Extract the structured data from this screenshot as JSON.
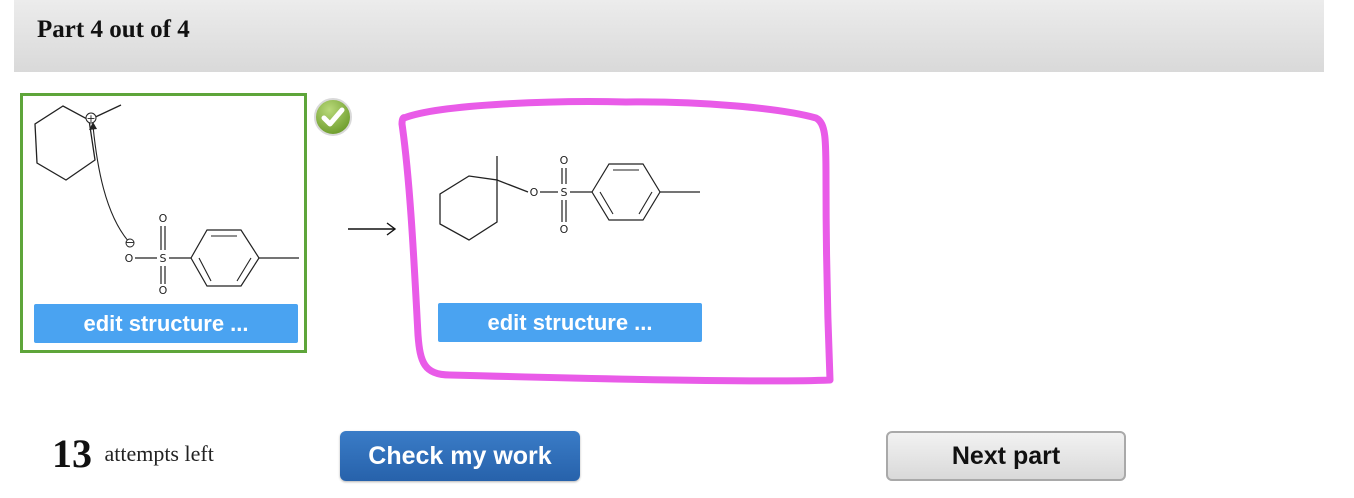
{
  "header": {
    "part_title": "Part 4 out of 4"
  },
  "reactant": {
    "edit_label": "edit structure ...",
    "atoms": {
      "o_minus": "O",
      "s": "S",
      "o_top": "O",
      "o_bottom": "O",
      "charge_plus": "+",
      "charge_minus": "−"
    },
    "status_icon": "check-icon"
  },
  "product": {
    "edit_label": "edit structure ...",
    "atoms": {
      "o_link": "O",
      "s": "S",
      "o_top": "O",
      "o_bottom": "O"
    }
  },
  "arrow_icon": "right-arrow-icon",
  "footer": {
    "attempts_count": "13",
    "attempts_label": "attempts left",
    "check_label": "Check my work",
    "next_label": "Next part"
  },
  "colors": {
    "correct_border": "#5ea53a",
    "edit_button": "#4aa3f1",
    "check_button": "#2762ab",
    "annotation": "#e95be8"
  }
}
